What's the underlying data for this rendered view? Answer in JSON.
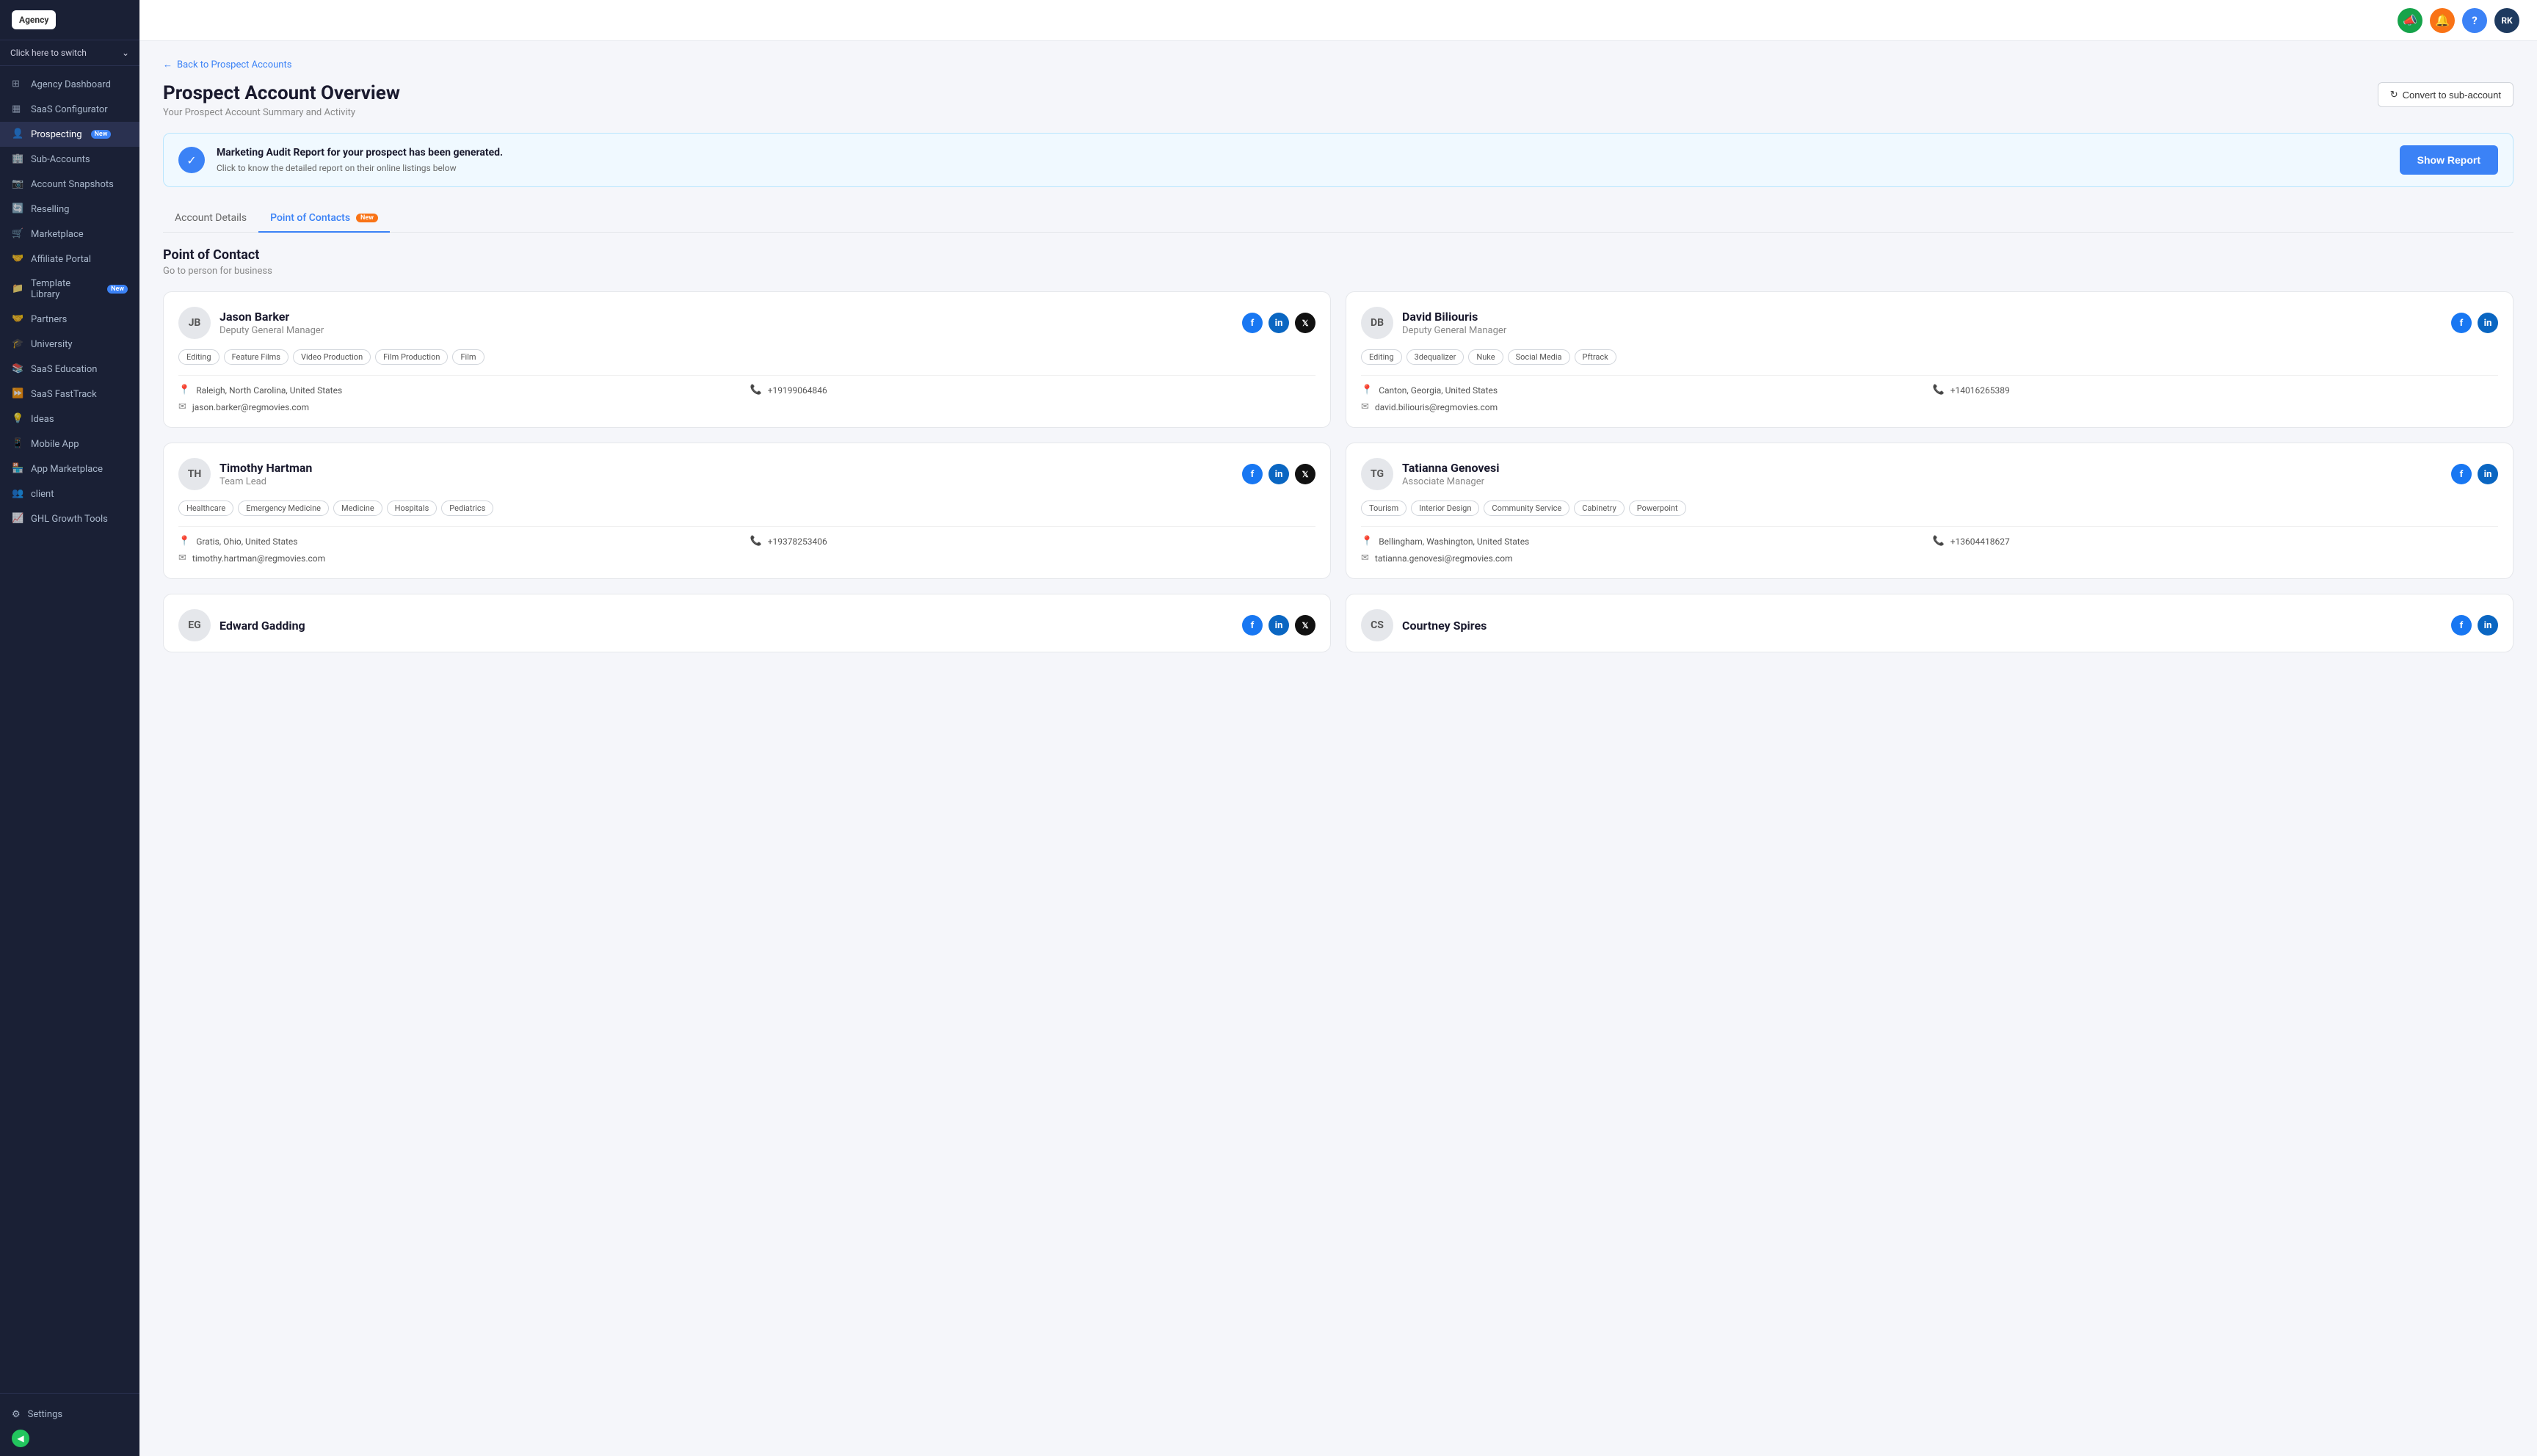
{
  "sidebar": {
    "logo": "Agency",
    "switcher_label": "Click here to switch",
    "items": [
      {
        "id": "agency-dashboard",
        "label": "Agency Dashboard",
        "icon": "⊞"
      },
      {
        "id": "saas-configurator",
        "label": "SaaS Configurator",
        "icon": "▦"
      },
      {
        "id": "prospecting",
        "label": "Prospecting",
        "icon": "👤",
        "badge": "New",
        "active": true
      },
      {
        "id": "sub-accounts",
        "label": "Sub-Accounts",
        "icon": "🏢"
      },
      {
        "id": "account-snapshots",
        "label": "Account Snapshots",
        "icon": "📷"
      },
      {
        "id": "reselling",
        "label": "Reselling",
        "icon": "🔄"
      },
      {
        "id": "marketplace",
        "label": "Marketplace",
        "icon": "🛒"
      },
      {
        "id": "affiliate-portal",
        "label": "Affiliate Portal",
        "icon": "🤝"
      },
      {
        "id": "template-library",
        "label": "Template Library",
        "icon": "📁",
        "badge": "New"
      },
      {
        "id": "partners",
        "label": "Partners",
        "icon": "🤝"
      },
      {
        "id": "university",
        "label": "University",
        "icon": "🎓"
      },
      {
        "id": "saas-education",
        "label": "SaaS Education",
        "icon": "📚"
      },
      {
        "id": "saas-fasttrack",
        "label": "SaaS FastTrack",
        "icon": "⏩"
      },
      {
        "id": "ideas",
        "label": "Ideas",
        "icon": "💡"
      },
      {
        "id": "mobile-app",
        "label": "Mobile App",
        "icon": "📱"
      },
      {
        "id": "app-marketplace",
        "label": "App Marketplace",
        "icon": "🏪"
      },
      {
        "id": "client",
        "label": "client",
        "icon": "👥"
      },
      {
        "id": "ghl-growth-tools",
        "label": "GHL Growth Tools",
        "icon": "📈"
      }
    ],
    "settings_label": "Settings",
    "collapse_icon": "◀"
  },
  "topbar": {
    "icons": [
      {
        "id": "megaphone",
        "color": "green",
        "symbol": "📣"
      },
      {
        "id": "bell",
        "color": "orange",
        "symbol": "🔔"
      },
      {
        "id": "help",
        "color": "blue",
        "symbol": "?"
      },
      {
        "id": "avatar",
        "color": "avatar",
        "symbol": "RK"
      }
    ]
  },
  "page": {
    "back_label": "Back to Prospect Accounts",
    "title": "Prospect Account Overview",
    "subtitle": "Your Prospect Account Summary and Activity",
    "convert_btn": "Convert to sub-account",
    "audit": {
      "title": "Marketing Audit Report for your prospect has been generated.",
      "subtitle": "Click to know the detailed report on their online listings below",
      "btn": "Show Report"
    },
    "tabs": [
      {
        "id": "account-details",
        "label": "Account Details",
        "active": false
      },
      {
        "id": "point-of-contacts",
        "label": "Point of Contacts",
        "badge": "New",
        "active": true
      }
    ],
    "poc_title": "Point of Contact",
    "poc_subtitle": "Go to person for business",
    "contacts": [
      {
        "id": "jb",
        "initials": "JB",
        "name": "Jason Barker",
        "role": "Deputy General Manager",
        "tags": [
          "Editing",
          "Feature Films",
          "Video Production",
          "Film Production",
          "Film"
        ],
        "location": "Raleigh, North Carolina, United States",
        "phone": "+19199064846",
        "email": "jason.barker@regmovies.com",
        "socials": [
          "fb",
          "li",
          "tw"
        ]
      },
      {
        "id": "db",
        "initials": "DB",
        "name": "David Biliouris",
        "role": "Deputy General Manager",
        "tags": [
          "Editing",
          "3dequalizer",
          "Nuke",
          "Social Media",
          "Pftrack"
        ],
        "location": "Canton, Georgia, United States",
        "phone": "+14016265389",
        "email": "david.biliouris@regmovies.com",
        "socials": [
          "fb",
          "li"
        ]
      },
      {
        "id": "th",
        "initials": "TH",
        "name": "Timothy Hartman",
        "role": "Team Lead",
        "tags": [
          "Healthcare",
          "Emergency Medicine",
          "Medicine",
          "Hospitals",
          "Pediatrics"
        ],
        "location": "Gratis, Ohio, United States",
        "phone": "+19378253406",
        "email": "timothy.hartman@regmovies.com",
        "socials": [
          "fb",
          "li",
          "tw"
        ]
      },
      {
        "id": "tg",
        "initials": "TG",
        "name": "Tatianna Genovesi",
        "role": "Associate Manager",
        "tags": [
          "Tourism",
          "Interior Design",
          "Community Service",
          "Cabinetry",
          "Powerpoint"
        ],
        "location": "Bellingham, Washington, United States",
        "phone": "+13604418627",
        "email": "tatianna.genovesi@regmovies.com",
        "socials": [
          "fb",
          "li"
        ]
      },
      {
        "id": "eg",
        "initials": "EG",
        "name": "Edward Gadding",
        "role": "",
        "tags": [],
        "location": "",
        "phone": "",
        "email": "",
        "socials": [
          "fb",
          "li",
          "tw"
        ]
      },
      {
        "id": "cs",
        "initials": "CS",
        "name": "Courtney Spires",
        "role": "",
        "tags": [],
        "location": "",
        "phone": "",
        "email": "",
        "socials": [
          "fb",
          "li"
        ]
      }
    ]
  }
}
